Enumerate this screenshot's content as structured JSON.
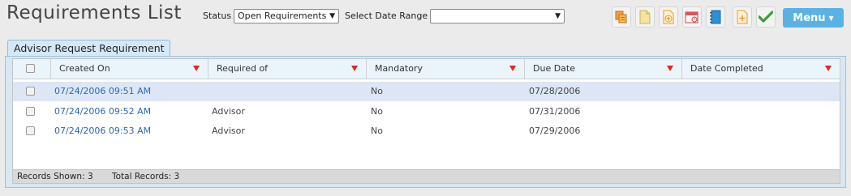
{
  "page_title": "Requirements List",
  "filters": {
    "status_label": "Status",
    "status_value": "Open Requirements",
    "date_range_label": "Select Date Range",
    "date_range_value": ""
  },
  "toolbar": {
    "icons": [
      "copy-icon",
      "document-icon",
      "add-document-icon",
      "calendar-icon",
      "notebook-icon",
      "add-icon",
      "checkmark-icon"
    ],
    "menu_label": "Menu"
  },
  "tab": {
    "label": "Advisor Request Requirement"
  },
  "table": {
    "columns": [
      "Created On",
      "Required of",
      "Mandatory",
      "Due Date",
      "Date Completed"
    ],
    "rows": [
      {
        "created_on": "07/24/2006 09:51 AM",
        "required_of": "",
        "mandatory": "No",
        "due_date": "07/28/2006",
        "date_completed": "",
        "selected": true
      },
      {
        "created_on": "07/24/2006 09:52 AM",
        "required_of": "Advisor",
        "mandatory": "No",
        "due_date": "07/31/2006",
        "date_completed": "",
        "selected": false
      },
      {
        "created_on": "07/24/2006 09:53 AM",
        "required_of": "Advisor",
        "mandatory": "No",
        "due_date": "07/29/2006",
        "date_completed": "",
        "selected": false
      }
    ]
  },
  "footer": {
    "records_shown": "Records Shown: 3",
    "total_records": "Total Records: 3"
  },
  "colors": {
    "accent": "#5ab2e4",
    "link": "#2a67b8",
    "filter_icon": "#e8231f",
    "selected_row": "#dde6f5"
  }
}
